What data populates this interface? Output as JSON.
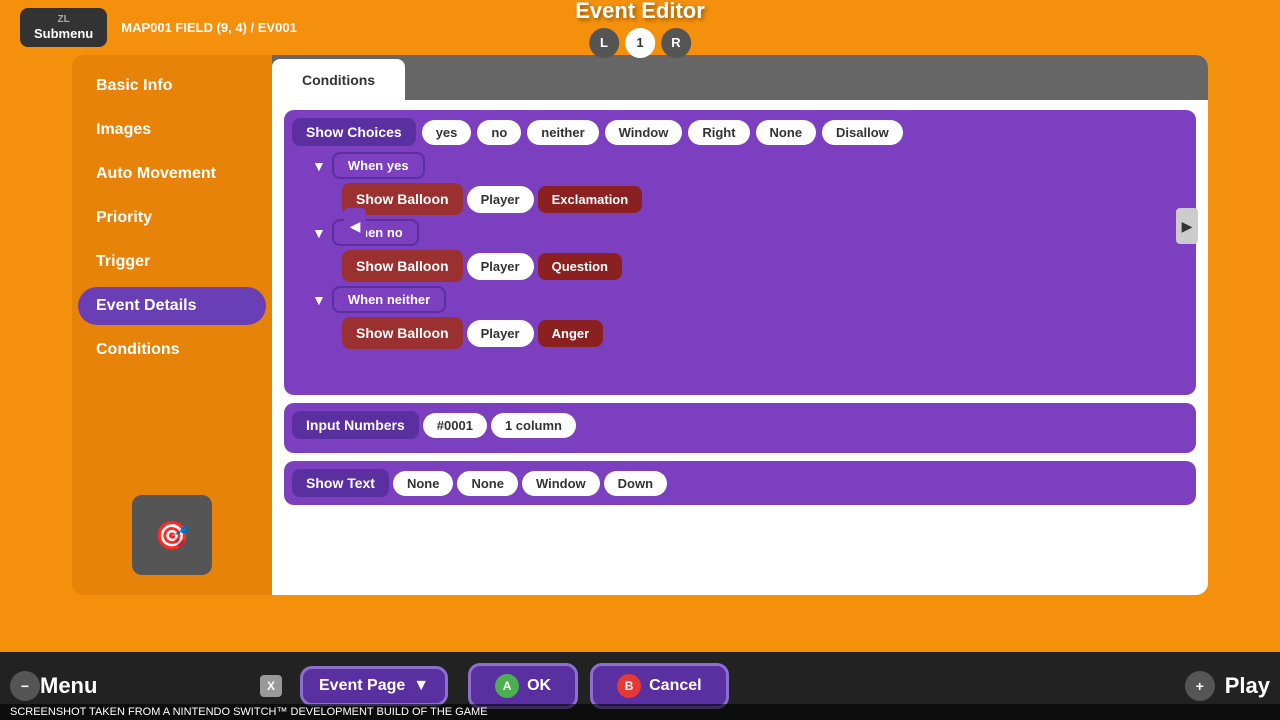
{
  "topBar": {
    "submenu": "Submenu",
    "zl": "ZL",
    "mapPath": "MAP001 FIELD (9, 4) / EV001",
    "title": "Event Editor",
    "tabs": [
      {
        "label": "L",
        "active": false
      },
      {
        "label": "1",
        "active": true
      },
      {
        "label": "R",
        "active": false
      }
    ]
  },
  "sidebar": {
    "items": [
      {
        "label": "Basic Info",
        "active": false
      },
      {
        "label": "Images",
        "active": false
      },
      {
        "label": "Auto Movement",
        "active": false
      },
      {
        "label": "Priority",
        "active": false
      },
      {
        "label": "Trigger",
        "active": false
      },
      {
        "label": "Event Details",
        "active": true
      },
      {
        "label": "Conditions",
        "active": false
      }
    ],
    "addButton": "+"
  },
  "contentTabs": [
    {
      "label": "Conditions",
      "active": false
    },
    {
      "label": "",
      "active": true
    }
  ],
  "eventBlocks": {
    "showChoices": {
      "label": "Show Choices",
      "options": [
        "yes",
        "no",
        "neither",
        "Window",
        "Right",
        "None",
        "Disallow"
      ]
    },
    "branches": [
      {
        "condition": "When yes",
        "action": "Show Balloon",
        "target": "Player",
        "value": "Exclamation"
      },
      {
        "condition": "When no",
        "action": "Show Balloon",
        "target": "Player",
        "value": "Question"
      },
      {
        "condition": "When neither",
        "action": "Show Balloon",
        "target": "Player",
        "value": "Anger"
      }
    ],
    "inputNumbers": {
      "label": "Input Numbers",
      "id": "#0001",
      "columns": "1 column"
    },
    "showText": {
      "label": "Show Text",
      "opts": [
        "None",
        "None",
        "Window",
        "Down"
      ]
    }
  },
  "bottomBar": {
    "menuLabel": "Menu",
    "eventPageLabel": "Event Page",
    "dropdownIcon": "▼",
    "okLabel": "OK",
    "cancelLabel": "Cancel",
    "playLabel": "Play",
    "xBadge": "X",
    "aBadge": "A",
    "bBadge": "B"
  },
  "screenshotNotice": "SCREENSHOT TAKEN FROM A NINTENDO SWITCH™ DEVELOPMENT BUILD OF THE GAME"
}
